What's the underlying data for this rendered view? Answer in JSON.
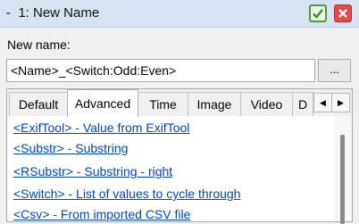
{
  "window": {
    "title": "-  1: New Name",
    "ok_icon": "checkmark-icon",
    "close_icon": "close-icon",
    "ok_color": "#4d9a3c",
    "close_color": "#e64848"
  },
  "form": {
    "label": "New name:",
    "value": "<Name>_<Switch:Odd:Even>",
    "browse_label": "..."
  },
  "tabs": [
    "Default",
    "Advanced",
    "Time",
    "Image",
    "Video",
    "D"
  ],
  "active_tab": "Advanced",
  "tab_scroll": {
    "left": "◀",
    "right": "▶"
  },
  "items": [
    "<ExifTool> - Value from ExifTool",
    "<Substr> - Substring",
    "<RSubstr> - Substring - right",
    "<Switch> - List of values to cycle through",
    "<Csv> - From imported CSV file"
  ]
}
